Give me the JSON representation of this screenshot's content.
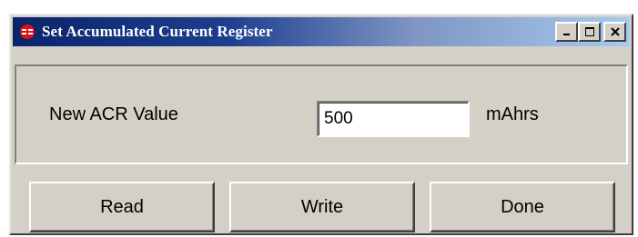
{
  "window": {
    "title": "Set Accumulated Current Register",
    "icon": "app-logo-icon",
    "accent_color": "#0a246a"
  },
  "form": {
    "acr_label": "New ACR Value",
    "acr_value": "500",
    "unit": "mAhrs"
  },
  "buttons": {
    "read": "Read",
    "write": "Write",
    "done": "Done"
  }
}
